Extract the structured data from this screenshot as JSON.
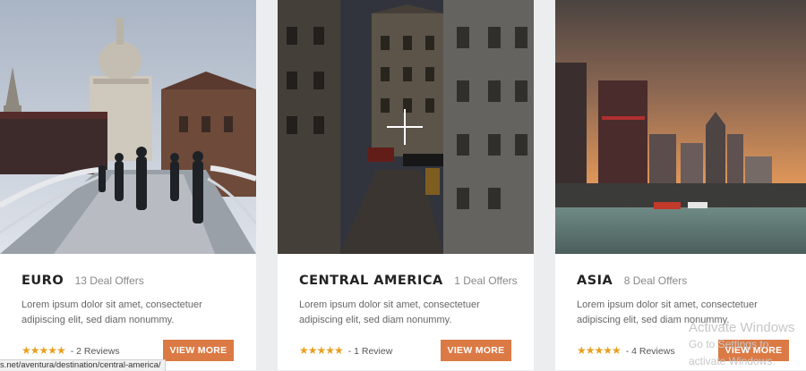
{
  "cards": [
    {
      "title": "EURO",
      "deal_offers": "13 Deal Offers",
      "description": "Lorem ipsum dolor sit amet, consectetuer adipiscing elit, sed diam nonummy.",
      "stars": "★★★★★",
      "reviews": "- 2 Reviews",
      "button_label": "VIEW MORE",
      "image": "london-bridge-cathedral-photo"
    },
    {
      "title": "CENTRAL AMERICA",
      "deal_offers": "1 Deal Offers",
      "description": "Lorem ipsum dolor sit amet, consectetuer adipiscing elit, sed diam nonummy.",
      "stars": "★★★★★",
      "reviews": "- 1 Review",
      "button_label": "VIEW MORE",
      "image": "paris-street-metropolitain-photo",
      "hovered": true
    },
    {
      "title": "ASIA",
      "deal_offers": "8 Deal Offers",
      "description": "Lorem ipsum dolor sit amet, consectetuer adipiscing elit, sed diam nonummy.",
      "stars": "★★★★★",
      "reviews": "- 4 Reviews",
      "button_label": "VIEW MORE",
      "image": "city-skyline-sunset-photo"
    }
  ],
  "status_bar": {
    "url": "s.net/aventura/destination/central-america/"
  },
  "watermark": {
    "title": "Activate Windows",
    "subtitle": "Go to Settings to activate Windows."
  },
  "colors": {
    "accent": "#dc7a45",
    "stars": "#e8a020"
  }
}
